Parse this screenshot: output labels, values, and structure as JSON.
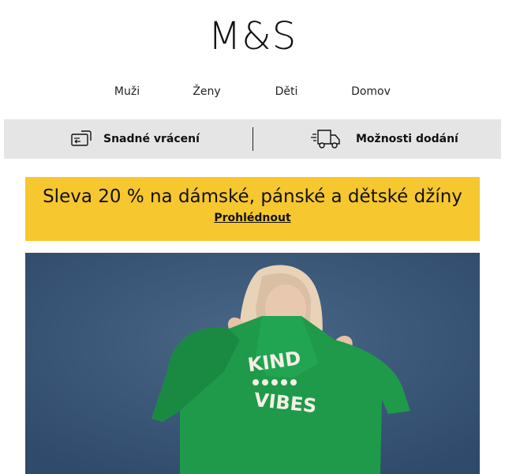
{
  "brand": {
    "logo_text": "M&S"
  },
  "nav": {
    "items": [
      {
        "label": "Muži"
      },
      {
        "label": "Ženy"
      },
      {
        "label": "Děti"
      },
      {
        "label": "Domov"
      }
    ]
  },
  "service_bar": {
    "returns": {
      "label": "Snadné vrácení",
      "icon": "return-card-icon"
    },
    "delivery": {
      "label": "Možnosti dodání",
      "icon": "delivery-truck-icon"
    }
  },
  "promo": {
    "headline": "Sleva 20 % na dámské, pánské a dětské džíny",
    "cta_label": "Prohlédnout",
    "background_color": "#f6c72f"
  },
  "hero": {
    "background_color": "#3c5879",
    "sweater_color": "#1e9a4a",
    "sweater_print_line1": "KIND",
    "sweater_print_line2": "VIBES"
  }
}
